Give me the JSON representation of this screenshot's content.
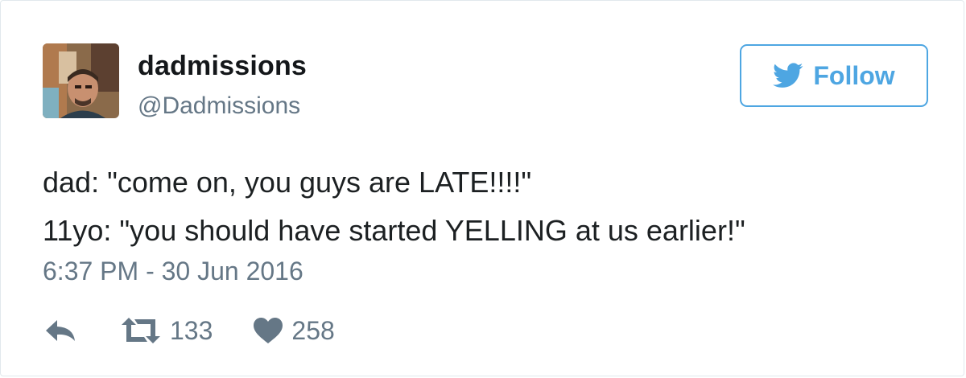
{
  "user": {
    "display_name": "dadmissions",
    "screen_name": "@Dadmissions"
  },
  "follow_button": {
    "label": "Follow",
    "icon": "twitter-bird-icon",
    "color": "#4ea6e2"
  },
  "tweet": {
    "lines": [
      "dad: \"come on, you guys are LATE!!!!\"",
      "11yo: \"you should have started YELLING at us earlier!\""
    ],
    "timestamp": "6:37 PM - 30 Jun 2016"
  },
  "actions": {
    "reply": {
      "icon": "reply-icon"
    },
    "retweet": {
      "icon": "retweet-icon",
      "count": "133"
    },
    "like": {
      "icon": "heart-icon",
      "count": "258"
    }
  },
  "colors": {
    "text": "#1c2022",
    "muted": "#657786",
    "accent": "#4ea6e2",
    "border": "#e1e8ed"
  }
}
